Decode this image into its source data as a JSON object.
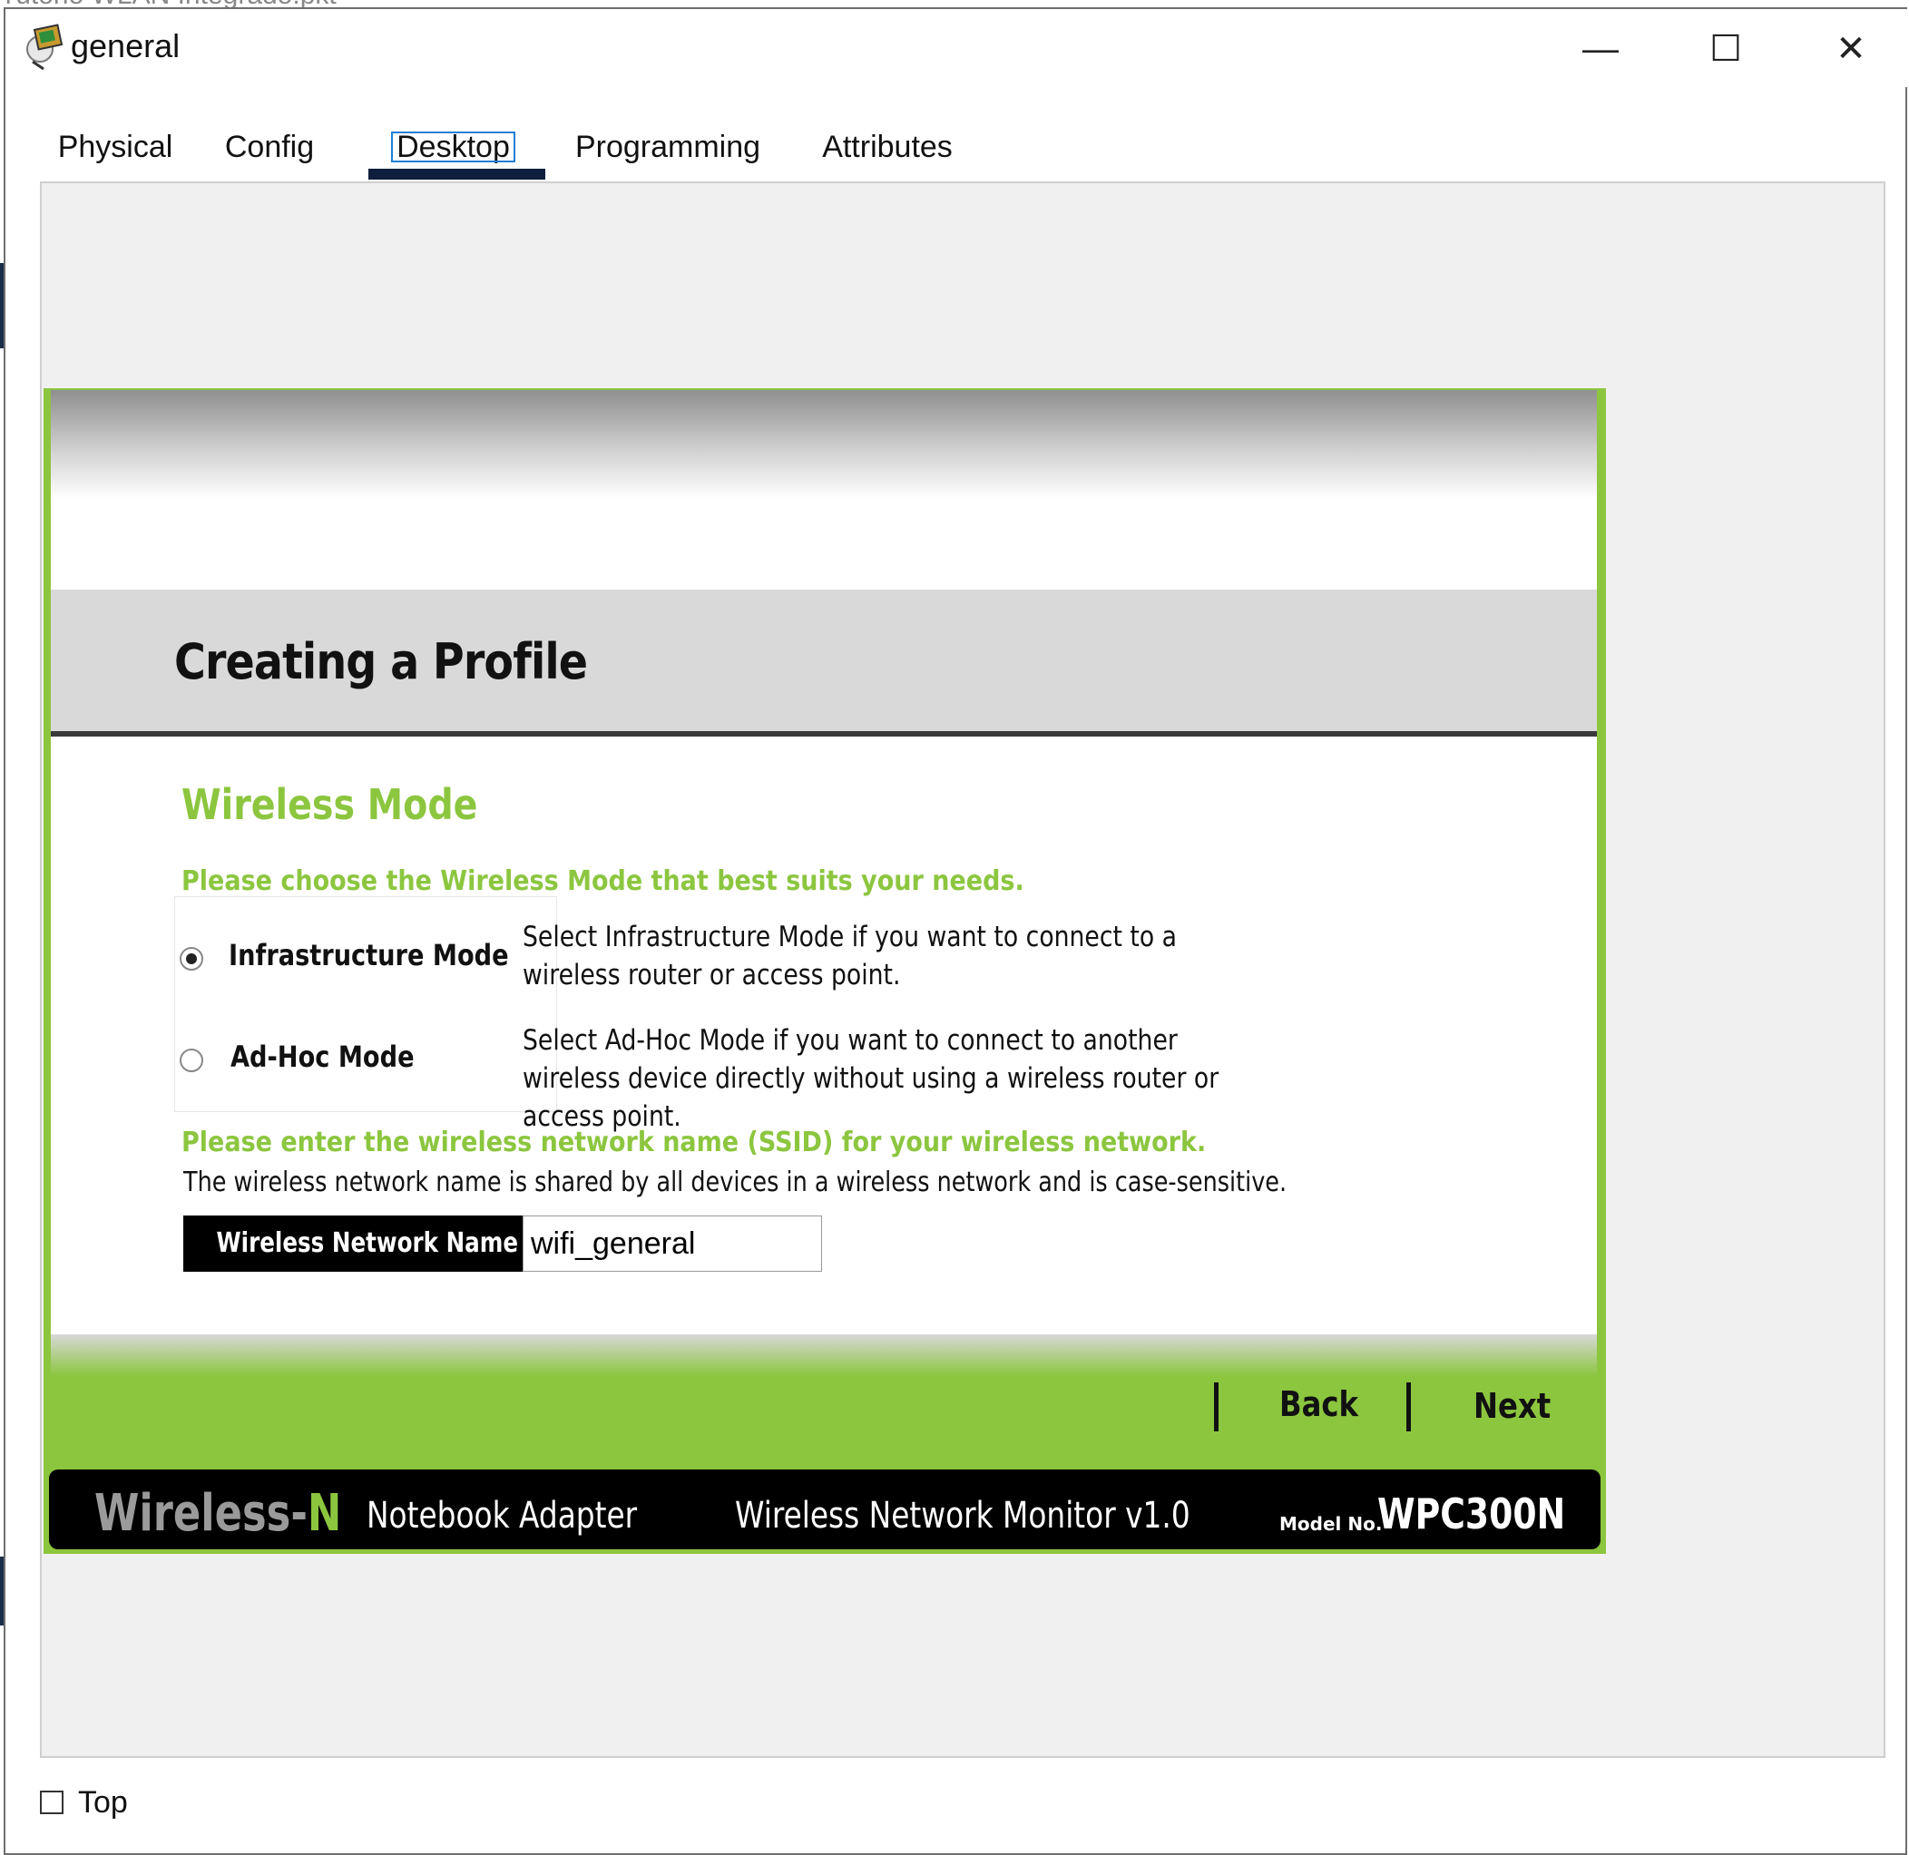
{
  "background": {
    "file_name": "Tutorio WLAN Integrado.pkt"
  },
  "window": {
    "title": "general",
    "controls": {
      "minimize": "—",
      "maximize": "☐",
      "close": "✕"
    }
  },
  "tabs": [
    {
      "label": "Physical",
      "active": false
    },
    {
      "label": "Config",
      "active": false
    },
    {
      "label": "Desktop",
      "active": true
    },
    {
      "label": "Programming",
      "active": false
    },
    {
      "label": "Attributes",
      "active": false
    }
  ],
  "wizard": {
    "header_title": "Creating a Profile",
    "mode_heading": "Wireless Mode",
    "mode_prompt": "Please choose the Wireless Mode that best suits your needs.",
    "modes": [
      {
        "label": "Infrastructure Mode",
        "selected": true,
        "description": "Select Infrastructure Mode if you want to connect to a wireless router or access point."
      },
      {
        "label": "Ad-Hoc Mode",
        "selected": false,
        "description": "Select Ad-Hoc Mode if you want to connect to another wireless device directly without using a wireless router or access point."
      }
    ],
    "ssid_prompt": "Please enter the wireless network name (SSID) for your wireless network.",
    "ssid_help": "The wireless network name is shared by all devices in a wireless network and is case-sensitive.",
    "ssid_label": "Wireless Network Name",
    "ssid_value": "wifi_general",
    "back_label": "Back",
    "next_label": "Next",
    "footer": {
      "brand": "Wireless-",
      "brand_n": "N",
      "product": "Notebook Adapter",
      "monitor": "Wireless Network Monitor  v1.0",
      "model_label": "Model No.",
      "model_value": "WPC300N"
    }
  },
  "bottom": {
    "top_checkbox_label": "Top",
    "top_checked": false
  },
  "colors": {
    "accent_green": "#8cc63f",
    "tab_underline": "#0e1e3c",
    "header_band": "#d9d9d9",
    "footer_black": "#000000"
  },
  "icons": {
    "app": "packet-tracer-pc-icon",
    "minimize": "minimize-icon",
    "maximize": "maximize-icon",
    "close": "close-icon"
  }
}
